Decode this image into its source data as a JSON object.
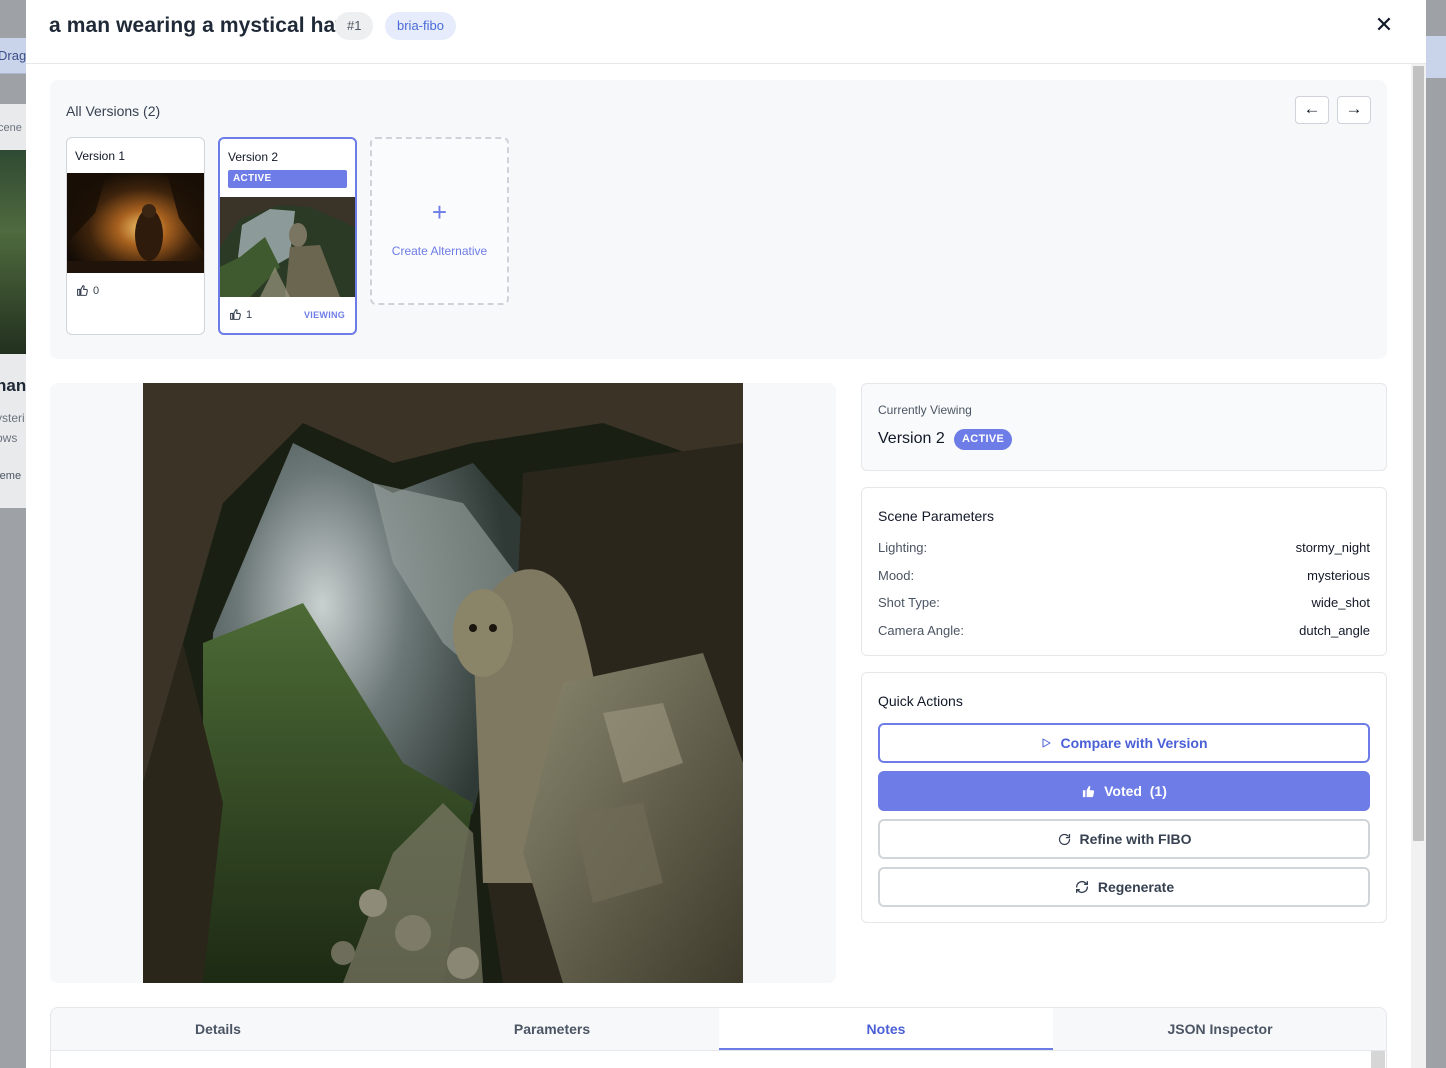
{
  "background": {
    "toolbar_fragment": "Drag",
    "card_label_fragment": "cene",
    "card_title_fragment": "nan",
    "card_desc_fragment_1": "ysteri",
    "card_desc_fragment_2": "ows",
    "card_footer_fragment": "reme"
  },
  "modal": {
    "title": "a man wearing a mystical hat",
    "id_badge": "#1",
    "model_badge": "bria-fibo",
    "close_symbol": "✕"
  },
  "versions": {
    "title": "All Versions (2)",
    "prev_symbol": "←",
    "next_symbol": "→",
    "items": [
      {
        "label": "Version 1",
        "votes": "0",
        "active": false
      },
      {
        "label": "Version 2",
        "votes": "1",
        "active": true,
        "active_label": "ACTIVE",
        "viewing_label": "VIEWING"
      }
    ],
    "create": {
      "symbol": "+",
      "label": "Create Alternative"
    }
  },
  "viewing": {
    "subtitle": "Currently Viewing",
    "version": "Version 2",
    "badge": "ACTIVE"
  },
  "scene": {
    "title": "Scene Parameters",
    "params": [
      {
        "key": "Lighting:",
        "value": "stormy_night"
      },
      {
        "key": "Mood:",
        "value": "mysterious"
      },
      {
        "key": "Shot Type:",
        "value": "wide_shot"
      },
      {
        "key": "Camera Angle:",
        "value": "dutch_angle"
      }
    ]
  },
  "actions": {
    "title": "Quick Actions",
    "compare": "Compare with Version",
    "voted": "Voted  (1)",
    "refine": "Refine with FIBO",
    "regenerate": "Regenerate"
  },
  "tabs": [
    {
      "label": "Details",
      "active": false
    },
    {
      "label": "Parameters",
      "active": false
    },
    {
      "label": "Notes",
      "active": true
    },
    {
      "label": "JSON Inspector",
      "active": false
    }
  ],
  "colors": {
    "accent": "#6d7ce6",
    "accent_text": "#4b5fd6"
  }
}
